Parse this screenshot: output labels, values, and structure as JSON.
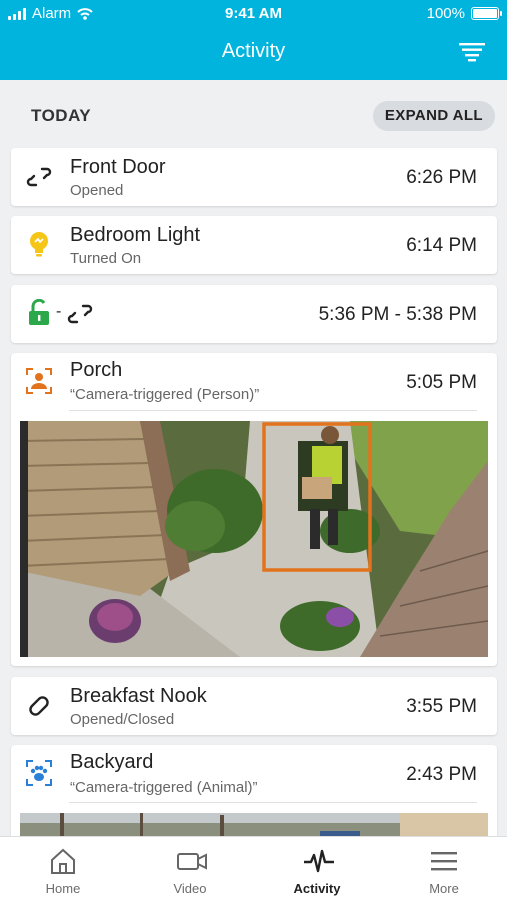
{
  "status": {
    "carrier": "Alarm",
    "time": "9:41 AM",
    "battery": "100%"
  },
  "header": {
    "title": "Activity"
  },
  "section": {
    "label": "TODAY",
    "expand_label": "EXPAND ALL"
  },
  "events": [
    {
      "name": "Front Door",
      "sub": "Opened",
      "time": "6:26 PM",
      "icon": "door-sensor-icon"
    },
    {
      "name": "Bedroom Light",
      "sub": "Turned On",
      "time": "6:14 PM",
      "icon": "light-bulb-icon"
    },
    {
      "name": "",
      "sub": "",
      "time": "5:36 PM - 5:38 PM",
      "icon": "unlock-and-door-sensor-icons"
    },
    {
      "name": "Porch",
      "sub": "“Camera-triggered (Person)”",
      "time": "5:05 PM",
      "icon": "camera-person-icon"
    },
    {
      "name": "Breakfast Nook",
      "sub": "Opened/Closed",
      "time": "3:55 PM",
      "icon": "window-sensor-icon"
    },
    {
      "name": "Backyard",
      "sub": "“Camera-triggered (Animal)”",
      "time": "2:43 PM",
      "icon": "camera-animal-icon"
    }
  ],
  "tabs": [
    {
      "label": "Home",
      "icon": "home-icon"
    },
    {
      "label": "Video",
      "icon": "video-camera-icon"
    },
    {
      "label": "Activity",
      "icon": "activity-pulse-icon",
      "active": true
    },
    {
      "label": "More",
      "icon": "menu-icon"
    }
  ],
  "colors": {
    "brand": "#00b4dd",
    "lock_green": "#2aa84a",
    "bulb_yellow": "#f5c518",
    "camera_orange": "#e2731c",
    "camera_blue": "#2a7fd6"
  }
}
